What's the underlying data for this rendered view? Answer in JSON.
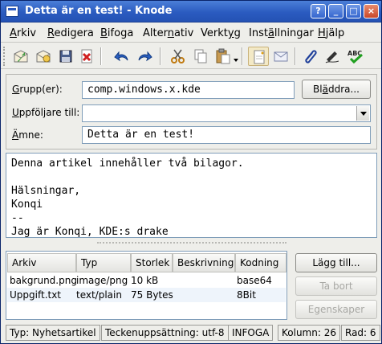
{
  "window": {
    "title": "Detta är en test! - Knode"
  },
  "titlebar_buttons": [
    "?",
    "_",
    "□",
    "×"
  ],
  "menu": [
    {
      "pre": "",
      "key": "A",
      "post": "rkiv"
    },
    {
      "pre": "",
      "key": "R",
      "post": "edigera"
    },
    {
      "pre": "",
      "key": "B",
      "post": "ifoga"
    },
    {
      "pre": "Alter",
      "key": "n",
      "post": "ativ"
    },
    {
      "pre": "Verkt",
      "key": "y",
      "post": "g"
    },
    {
      "pre": "Inst",
      "key": "ä",
      "post": "llningar"
    },
    {
      "pre": "",
      "key": "H",
      "post": "jälp"
    }
  ],
  "toolbar": {
    "icons": [
      "send-now-icon",
      "send-later-icon",
      "save-icon",
      "delete-icon",
      "undo-icon",
      "redo-icon",
      "cut-icon",
      "copy-icon",
      "paste-icon",
      "new-attachment-icon",
      "mail-icon",
      "attach-icon",
      "sign-icon",
      "spellcheck-icon"
    ],
    "spellcheck_label": "ABC"
  },
  "header": {
    "groups_label": {
      "key": "G",
      "rest": "rupp(er):"
    },
    "groups_value": "comp.windows.x.kde",
    "browse_button": {
      "pre": "Bl",
      "key": "ä",
      "post": "ddra..."
    },
    "followup_label": {
      "key": "U",
      "rest": "ppföljare till:"
    },
    "followup_value": "",
    "subject_label": {
      "key": "Ä",
      "rest": "mne:"
    },
    "subject_value": "Detta är en test!"
  },
  "body_lines": [
    "Denna artikel innehåller två bilagor.",
    "",
    "Hälsningar,",
    "Konqi",
    "--",
    "Jag är Konqi, KDE:s drake"
  ],
  "attachments": {
    "columns": [
      "Arkiv",
      "Typ",
      "Storlek",
      "Beskrivning",
      "Kodning"
    ],
    "rows": [
      [
        "bakgrund.png",
        "image/png",
        "10 kB",
        "",
        "base64"
      ],
      [
        "Uppgift.txt",
        "text/plain",
        "75 Bytes",
        "",
        "8Bit"
      ]
    ],
    "buttons": {
      "add": "Lägg till...",
      "remove": "Ta bort",
      "properties": "Egenskaper"
    }
  },
  "status": {
    "type": "Typ: Nyhetsartikel",
    "charset": "Teckenuppsättning: utf-8",
    "mode": "INFOGA",
    "column": "Kolumn: 26",
    "row": "Rad: 6"
  }
}
